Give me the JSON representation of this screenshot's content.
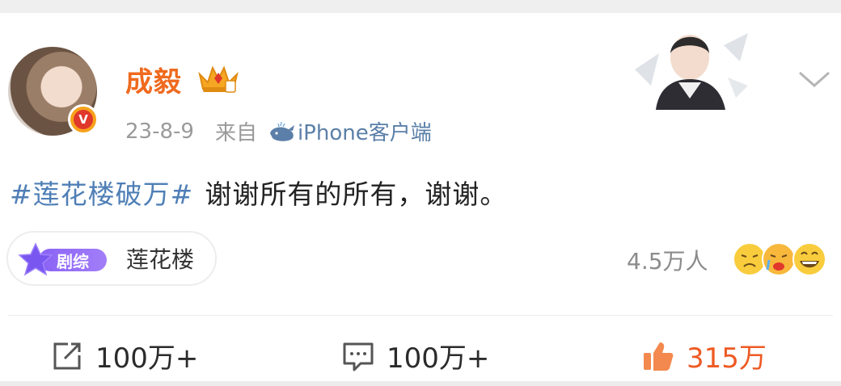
{
  "post": {
    "username": "成毅",
    "date": "23-8-9",
    "source_label": "来自",
    "source_app": "iPhone客户端",
    "verify_mark": "V",
    "hashtag": "#莲花楼破万#",
    "text": "谢谢所有的所有，谢谢。",
    "icons": {
      "avatar": "avatar",
      "verify": "verified-badge-icon",
      "crown": "crown-icon",
      "whale": "whale-icon",
      "more": "chevron-down-icon"
    }
  },
  "tag_chip": {
    "badge": "剧综",
    "label": "莲花楼"
  },
  "reactions": {
    "count": "4.5万人",
    "emojis": [
      "sad-face-icon",
      "crying-face-icon",
      "laughing-face-icon"
    ]
  },
  "actions": {
    "repost": {
      "icon": "share-icon",
      "count": "100万+"
    },
    "comment": {
      "icon": "comment-icon",
      "count": "100万+"
    },
    "like": {
      "icon": "thumbs-up-icon",
      "count": "315万",
      "color": "#ee5a24"
    }
  },
  "colors": {
    "username": "#ef6a1f",
    "hashtag": "#4f7fb6",
    "source_app": "#5b7fa8",
    "chip_purple": "#8a62f6"
  }
}
